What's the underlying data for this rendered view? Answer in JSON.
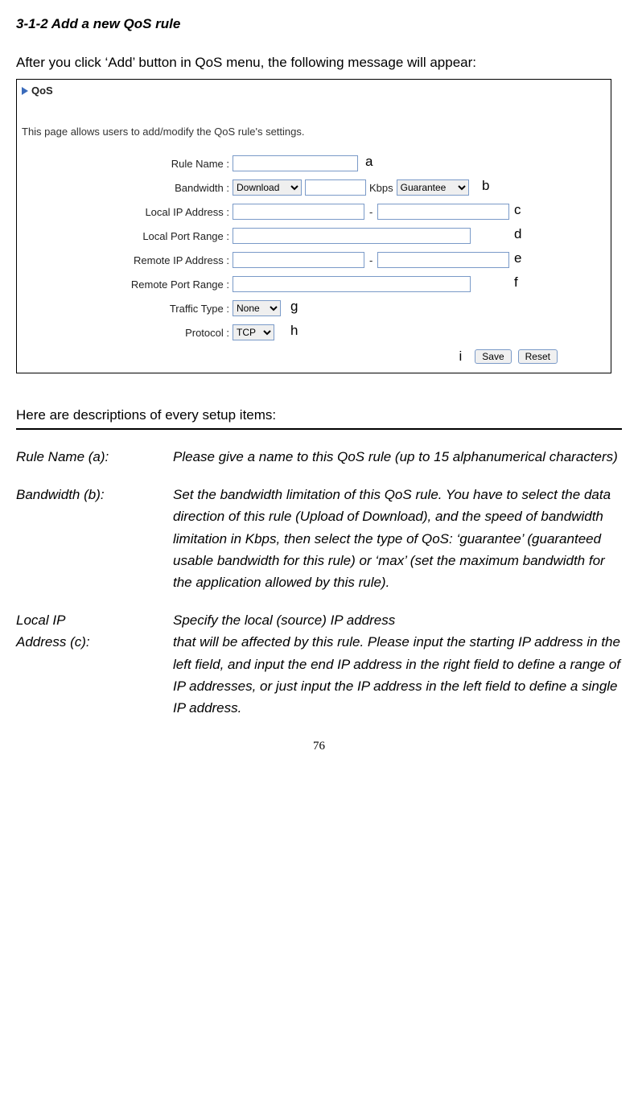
{
  "heading": "3-1-2 Add a new QoS rule",
  "intro": "After you click ‘Add’ button in QoS menu, the following message will appear:",
  "screenshot": {
    "title": "QoS",
    "desc": "This page allows users to add/modify the QoS rule's settings.",
    "labels": {
      "rule_name": "Rule Name :",
      "bandwidth": "Bandwidth :",
      "local_ip": "Local IP Address :",
      "local_port": "Local Port Range :",
      "remote_ip": "Remote IP Address :",
      "remote_port": "Remote Port Range :",
      "traffic_type": "Traffic Type :",
      "protocol": "Protocol :"
    },
    "selects": {
      "bandwidth_dir": "Download",
      "bandwidth_type": "Guarantee",
      "traffic_type": "None",
      "protocol": "TCP"
    },
    "kbps": "Kbps",
    "buttons": {
      "save": "Save",
      "reset": "Reset"
    },
    "annotations": {
      "a": "a",
      "b": "b",
      "c": "c",
      "d": "d",
      "e": "e",
      "f": "f",
      "g": "g",
      "h": "h",
      "i": "i"
    }
  },
  "after_box": "Here are descriptions of every setup items:",
  "descriptions": {
    "rule_name": {
      "label": "Rule Name (a):",
      "text": "Please give a name to this QoS rule (up to 15 alphanumerical characters)"
    },
    "bandwidth": {
      "label": "Bandwidth (b):",
      "text": "Set the bandwidth limitation of this QoS rule. You have to select the data direction of this rule (Upload of Download), and the speed of bandwidth limitation in Kbps, then select the type of QoS: ‘guarantee’ (guaranteed usable bandwidth for this rule) or ‘max’ (set the maximum bandwidth for the application allowed by this rule)."
    },
    "local_ip": {
      "label1": "Local IP",
      "label2": "Address (c):",
      "text1": "Specify the local (source) IP address",
      "text2": "that will be affected by this rule. Please input the starting IP address in the left field, and input the end IP address in the right field to define a range of IP addresses, or just input the IP address in the left field to define a single IP address."
    }
  },
  "page_num": "76"
}
